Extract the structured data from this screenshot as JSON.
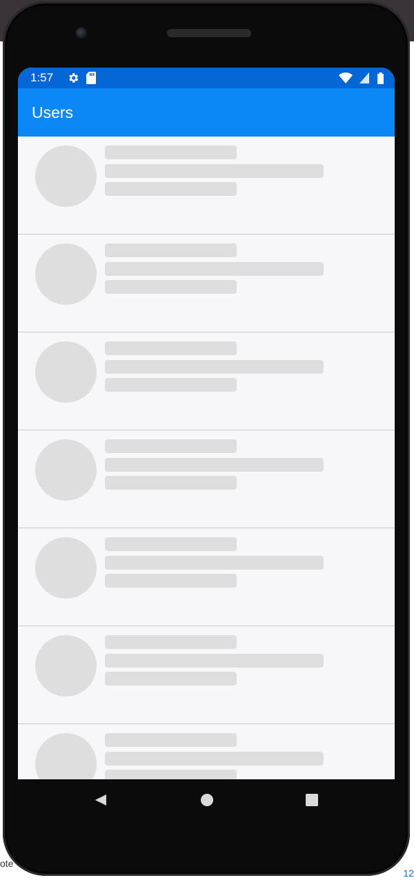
{
  "status_bar": {
    "time": "1:57",
    "icons": [
      "gear-icon",
      "sd-card-icon",
      "wifi-icon",
      "signal-icon",
      "battery-icon"
    ]
  },
  "app_bar": {
    "title": "Users"
  },
  "list": {
    "placeholder_rows": 7
  },
  "nav_bar": {
    "buttons": [
      "back-icon",
      "home-icon",
      "recent-apps-icon"
    ]
  },
  "backdrop": {
    "left_fragment": "ote",
    "right_fragment": "12"
  },
  "colors": {
    "status_bar": "#0567d6",
    "app_bar": "#0b88f5",
    "skeleton": "#dedede",
    "screen_bg": "#f7f6f9"
  }
}
